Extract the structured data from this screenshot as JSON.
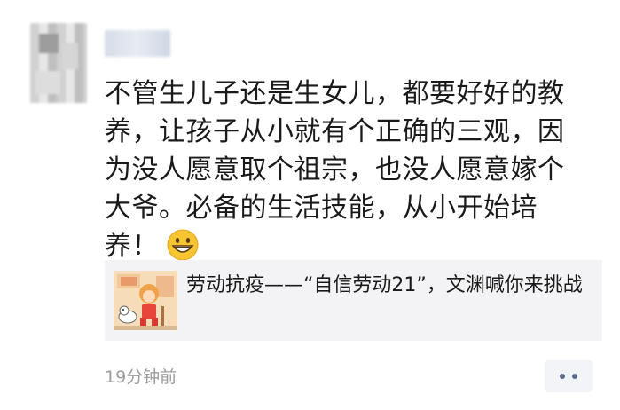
{
  "post": {
    "text": "不管生儿子还是生女儿，都要好好的教养，让孩子从小就有个正确的三观，因为没人愿意取个祖宗，也没人愿意嫁个大爷。必备的生活技能，从小开始培养！",
    "emoji_icon": "grinning-face-emoji"
  },
  "share": {
    "title": "劳动抗疫——“自信劳动21”，文渊喊你来挑战"
  },
  "footer": {
    "timestamp": "19分钟前"
  }
}
